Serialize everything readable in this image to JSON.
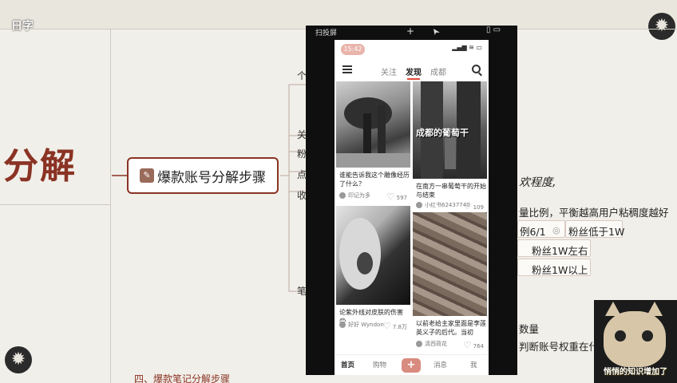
{
  "slide": {
    "logo": "日字",
    "title": "分解",
    "root_node": "爆款账号分解步骤",
    "branch_chars": [
      "个",
      "关",
      "粉",
      "点",
      "收",
      "笔"
    ],
    "right_lines": [
      "欢程度,",
      "量比例，平衡越高用户粘稠度越好",
      "例6/1",
      "粉丝低于1W",
      "粉丝1W左右",
      "粉丝1W以上",
      "数量",
      "判断账号权重在什么"
    ],
    "bottom_text": "四、爆款笔记分解步骤"
  },
  "phone_window": {
    "title": "扫投屏",
    "plus": "+",
    "time": "15:42",
    "status_icons": "▂▄▆ ≋ ▭",
    "nav": {
      "tabs": [
        "关注",
        "发现",
        "成都"
      ],
      "active_tab": "发现"
    },
    "feed": [
      {
        "title": "谁能告诉我这个雕像经历了什么？",
        "author": "印记为多",
        "likes": "597"
      },
      {
        "title": "在南方一串葡萄干的开始与结束",
        "author": "小红书62437740",
        "likes": "109",
        "overlay": "成都的葡萄干"
      },
      {
        "title": "论紫外线对皮肤的伤害😊",
        "author": "好好 Wyndon",
        "likes": "7.8万"
      },
      {
        "title": "以前老给主家里面是李莲英义子的后代。当初",
        "author": "清西荷花",
        "likes": "764"
      }
    ],
    "tabbar": {
      "tabs": [
        "首页",
        "购物",
        "消息",
        "我"
      ],
      "active": "首页",
      "plus_label": "+"
    }
  },
  "webcam": {
    "caption": "悄悄的知识增加了"
  },
  "colors": {
    "accent": "#8a3324",
    "slide_bg": "#f1efe9",
    "xhs_red": "#e04a3a",
    "plus_btn": "#d98b7f"
  }
}
